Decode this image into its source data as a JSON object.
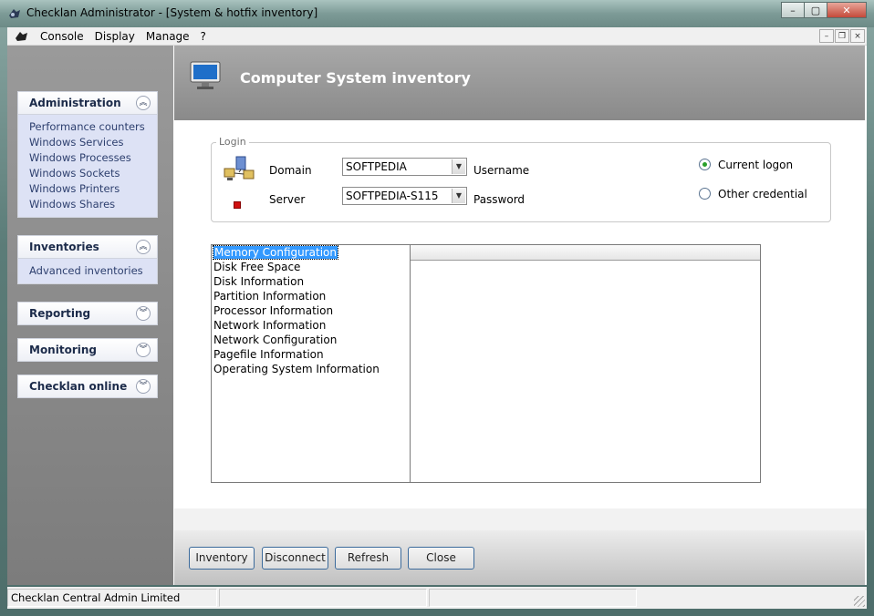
{
  "window": {
    "title": "Checklan Administrator - [System & hotfix inventory]",
    "controls": {
      "minimize": "–",
      "maximize": "▢",
      "close": "✕"
    }
  },
  "menubar": {
    "items": [
      "Console",
      "Display",
      "Manage",
      "?"
    ],
    "mdi": {
      "minimize": "–",
      "restore": "❐",
      "close": "×"
    }
  },
  "sidebar": {
    "panels": [
      {
        "title": "Administration",
        "chevron": "︽",
        "links": [
          "Performance counters",
          "Windows Services",
          "Windows Processes",
          "Windows Sockets",
          "Windows Printers",
          "Windows Shares"
        ]
      },
      {
        "title": "Inventories",
        "chevron": "︽",
        "links": [
          "Advanced inventories"
        ]
      },
      {
        "title": "Reporting",
        "chevron": "︾",
        "links": []
      },
      {
        "title": "Monitoring",
        "chevron": "︾",
        "links": []
      },
      {
        "title": "Checklan online",
        "chevron": "︾",
        "links": []
      }
    ]
  },
  "main": {
    "title": "Computer System  inventory",
    "login": {
      "legend": "Login",
      "domain_label": "Domain",
      "domain_value": "SOFTPEDIA",
      "server_label": "Server",
      "server_value": "SOFTPEDIA-S115",
      "username_label": "Username",
      "password_label": "Password",
      "radio_current": "Current logon",
      "radio_other": "Other credential",
      "selected_radio": "current"
    },
    "inventory_list": {
      "items": [
        "Memory Configuration",
        "Disk Free Space",
        "Disk Information",
        "Partition Information",
        "Processor Information",
        "Network Information",
        "Network Configuration",
        "Pagefile Information",
        "Operating System Information"
      ],
      "selected_index": 0
    },
    "buttons": {
      "inventory": "Inventory",
      "disconnect": "Disconnect",
      "refresh": "Refresh",
      "close": "Close"
    }
  },
  "statusbar": {
    "cells": [
      "Checklan Central Admin Limited",
      "",
      ""
    ]
  },
  "colors": {
    "accent": "#3399ff",
    "sidebar_body": "#dde2f5",
    "header": "#8a8a8a",
    "status_dot": "#d01010"
  },
  "icons": [
    "app-icon",
    "menu-console-icon",
    "monitor-icon",
    "network-icon",
    "status-dot-icon",
    "chevron-up-icon",
    "chevron-down-icon",
    "dropdown-arrow-icon"
  ]
}
